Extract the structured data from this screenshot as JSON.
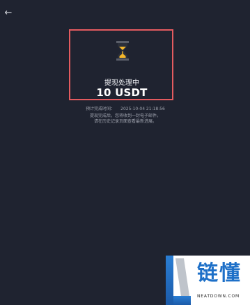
{
  "header": {
    "back_icon": "arrow-left-icon",
    "back_glyph": "←"
  },
  "status": {
    "icon": "hourglass-icon",
    "title": "提现处理中",
    "amount": "10 USDT",
    "eta_label": "预计完成时间：",
    "eta_value": "2025-10-04 21:18:56",
    "note_line1": "提现完成后，您将收到一封电子邮件。",
    "note_line2": "请在历史记录页面查看最新进展。",
    "highlight_color": "#e45b5f"
  },
  "watermark": {
    "brand": "链懂",
    "domain": "NEATDOWN.COM",
    "brand_color": "#1e70c8"
  }
}
